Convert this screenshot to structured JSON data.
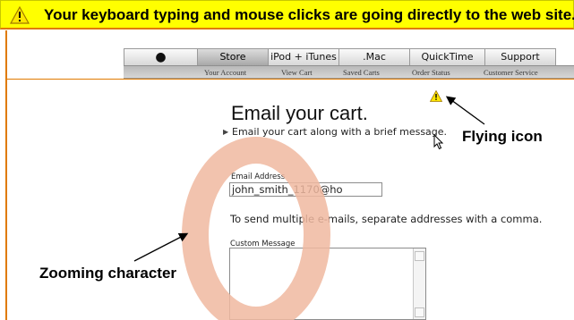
{
  "banner": {
    "text": "Your keyboard typing and mouse clicks are going directly to the web site.",
    "icon": "warning-icon",
    "color": "#ffff00"
  },
  "nav": {
    "tabs": [
      {
        "label": "",
        "icon": "apple-icon"
      },
      {
        "label": "Store",
        "active": true
      },
      {
        "label": "iPod + iTunes"
      },
      {
        "label": ".Mac"
      },
      {
        "label": "QuickTime"
      },
      {
        "label": "Support"
      }
    ],
    "subnav": [
      "Your Account",
      "View Cart",
      "Saved Carts",
      "Order Status",
      "Customer Service"
    ]
  },
  "page": {
    "title": "Email your cart.",
    "subtitle": "Email your cart along with a brief message.",
    "email_label": "Email Address",
    "email_value": "john_smith_1170@ho",
    "multi_note": "To send multiple e-mails, separate addresses with a comma.",
    "message_label": "Custom Message"
  },
  "overlay": {
    "zoom_char": "O",
    "zoom_color": "#f0b9a0"
  },
  "annotations": {
    "flying_icon": "Flying icon",
    "zooming_character": "Zooming character"
  }
}
